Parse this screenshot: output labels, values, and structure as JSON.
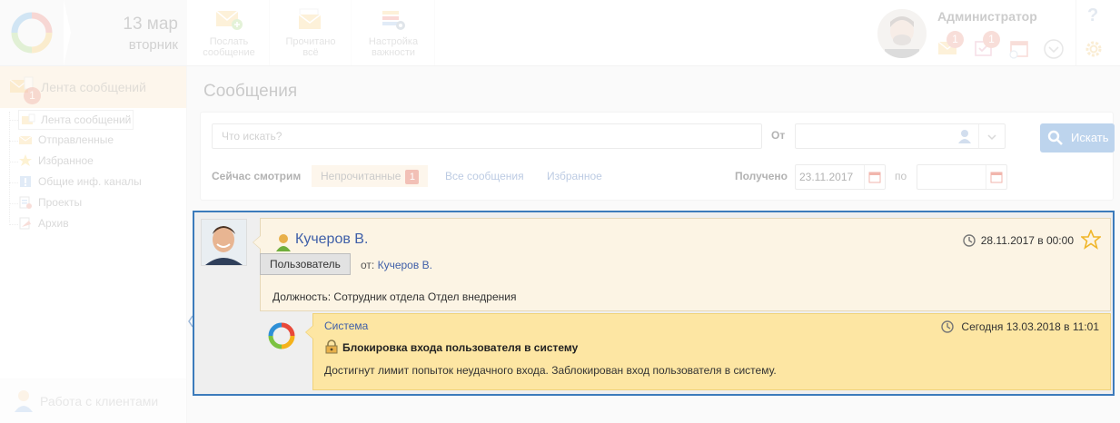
{
  "header": {
    "date_day": "13 мар",
    "date_weekday": "вторник",
    "toolbar": [
      {
        "label": "Послать\nсообщение",
        "icon": "send-message-icon"
      },
      {
        "label": "Прочитано\nвсё",
        "icon": "read-all-icon"
      },
      {
        "label": "Настройка\nважности",
        "icon": "importance-settings-icon"
      }
    ],
    "user_name": "Администратор",
    "mail_badge": "1",
    "tasks_badge": "1",
    "help_label": "?"
  },
  "sidebar": {
    "feed_title": "Лента сообщений",
    "feed_badge": "1",
    "items": [
      {
        "label": "Лента сообщений",
        "icon": "feed-icon"
      },
      {
        "label": "Отправленные",
        "icon": "sent-icon"
      },
      {
        "label": "Избранное",
        "icon": "star-icon"
      },
      {
        "label": "Общие инф. каналы",
        "icon": "channels-icon"
      },
      {
        "label": "Проекты",
        "icon": "projects-icon"
      },
      {
        "label": "Архив",
        "icon": "archive-icon"
      }
    ],
    "clients_label": "Работа с клиентами"
  },
  "main": {
    "title": "Сообщения",
    "search_placeholder": "Что искать?",
    "from_label": "От",
    "search_button": "Искать",
    "viewing_label": "Сейчас смотрим",
    "tabs": [
      {
        "label": "Непрочитанные",
        "count": "1"
      },
      {
        "label": "Все сообщения"
      },
      {
        "label": "Избранное"
      }
    ],
    "received_label": "Получено",
    "date_from": "23.11.2017",
    "to_label": "по"
  },
  "message": {
    "sender": "Кучеров В.",
    "date": "28.11.2017 в 00:00",
    "role": "Пользователь",
    "from_prefix": "от:",
    "from_name": "Кучеров В.",
    "body": "Должность: Сотрудник отдела Отдел внедрения",
    "reply": {
      "sender": "Система",
      "date": "Сегодня 13.03.2018 в 11:01",
      "subject": "Блокировка входа пользователя в систему",
      "body": "Достигнут лимит попыток неудачного входа. Заблокирован вход пользователя в систему."
    }
  },
  "colors": {
    "accent": "#3c7bbb",
    "link": "#3f5fa8",
    "badge": "#e05e4a",
    "message_bg": "#fcf4e4",
    "system_bg": "#fde6a3"
  }
}
